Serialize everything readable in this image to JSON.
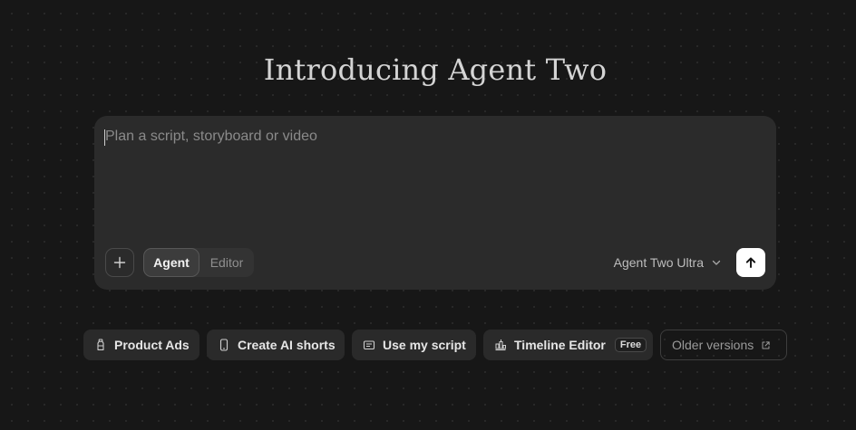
{
  "hero": {
    "title": "Introducing Agent Two"
  },
  "composer": {
    "prompt_value": "",
    "prompt_placeholder": "Plan a script, storyboard or video",
    "attach_icon": "plus-icon",
    "modes": [
      {
        "label": "Agent",
        "selected": true
      },
      {
        "label": "Editor",
        "selected": false
      }
    ],
    "model": {
      "selected": "Agent Two Ultra",
      "icon": "chevron-down-icon"
    },
    "send_icon": "arrow-up-icon"
  },
  "quick_actions": [
    {
      "label": "Product Ads",
      "icon": "bottle-icon"
    },
    {
      "label": "Create AI shorts",
      "icon": "phone-icon"
    },
    {
      "label": "Use my script",
      "icon": "document-icon"
    },
    {
      "label": "Timeline Editor",
      "icon": "timeline-icon",
      "badge": "Free"
    },
    {
      "label": "Older versions",
      "icon": "external-link-icon"
    }
  ],
  "colors": {
    "background": "#171717",
    "composer_bg": "#2b2b2b",
    "send_button": "#ffffff",
    "chip_bg": "#2a2a2a"
  }
}
